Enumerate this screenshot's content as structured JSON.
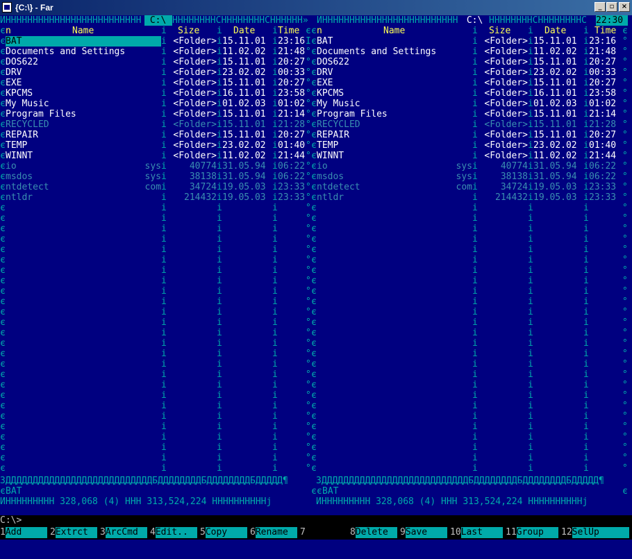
{
  "window": {
    "title": "{C:\\} - Far",
    "btn_min": "_",
    "btn_max": "▫",
    "btn_close": "×"
  },
  "clock": "22:30",
  "left_panel": {
    "path": " C:\\ ",
    "headers": {
      "n": "n",
      "name": "Name",
      "size": "Size",
      "date": "Date",
      "time": "Time"
    },
    "files": [
      {
        "name": "BAT",
        "size": "<Folder>",
        "date": "15.11.01",
        "time": "23:16",
        "type": "folder",
        "selected": true
      },
      {
        "name": "Documents and Settings",
        "size": "<Folder>",
        "date": "11.02.02",
        "time": "21:48",
        "type": "folder"
      },
      {
        "name": "DOS622",
        "size": "<Folder>",
        "date": "15.11.01",
        "time": "20:27",
        "type": "folder"
      },
      {
        "name": "DRV",
        "size": "<Folder>",
        "date": "23.02.02",
        "time": "00:33",
        "type": "folder"
      },
      {
        "name": "EXE",
        "size": "<Folder>",
        "date": "15.11.01",
        "time": "20:27",
        "type": "folder"
      },
      {
        "name": "KPCMS",
        "size": "<Folder>",
        "date": "16.11.01",
        "time": "23:58",
        "type": "folder"
      },
      {
        "name": "My Music",
        "size": "<Folder>",
        "date": "01.02.03",
        "time": "01:02",
        "type": "folder"
      },
      {
        "name": "Program Files",
        "size": "<Folder>",
        "date": "15.11.01",
        "time": "21:14",
        "type": "folder"
      },
      {
        "name": "RECYCLED",
        "size": "<Folder>",
        "date": "15.11.01",
        "time": "21:28",
        "type": "hidden"
      },
      {
        "name": "REPAIR",
        "size": "<Folder>",
        "date": "15.11.01",
        "time": "20:27",
        "type": "folder"
      },
      {
        "name": "TEMP",
        "size": "<Folder>",
        "date": "23.02.02",
        "time": "01:40",
        "type": "folder"
      },
      {
        "name": "WINNT",
        "size": "<Folder>",
        "date": "11.02.02",
        "time": "21:44",
        "type": "folder"
      },
      {
        "name": "io",
        "ext": "sys",
        "size": "40774",
        "date": "31.05.94",
        "time": "06:22",
        "type": "hidden"
      },
      {
        "name": "msdos",
        "ext": "sys",
        "size": "38138",
        "date": "31.05.94",
        "time": "06:22",
        "type": "hidden"
      },
      {
        "name": "ntdetect",
        "ext": "com",
        "size": "34724",
        "date": "19.05.03",
        "time": "23:33",
        "type": "hidden"
      },
      {
        "name": "ntldr",
        "ext": "",
        "size": "214432",
        "date": "19.05.03",
        "time": "23:33",
        "type": "hidden"
      }
    ],
    "current": "BAT",
    "summary": "ИННННННННН 328,068 (4) ННН 313,524,224 ННННННННННј"
  },
  "right_panel": {
    "path": " C:\\ ",
    "headers": {
      "n": "n",
      "name": "Name",
      "size": "Size",
      "date": "Date",
      "time": "Time"
    },
    "files": [
      {
        "name": "BAT",
        "size": "<Folder>",
        "date": "15.11.01",
        "time": "23:16",
        "type": "folder"
      },
      {
        "name": "Documents and Settings",
        "size": "<Folder>",
        "date": "11.02.02",
        "time": "21:48",
        "type": "folder"
      },
      {
        "name": "DOS622",
        "size": "<Folder>",
        "date": "15.11.01",
        "time": "20:27",
        "type": "folder"
      },
      {
        "name": "DRV",
        "size": "<Folder>",
        "date": "23.02.02",
        "time": "00:33",
        "type": "folder"
      },
      {
        "name": "EXE",
        "size": "<Folder>",
        "date": "15.11.01",
        "time": "20:27",
        "type": "folder"
      },
      {
        "name": "KPCMS",
        "size": "<Folder>",
        "date": "16.11.01",
        "time": "23:58",
        "type": "folder"
      },
      {
        "name": "My Music",
        "size": "<Folder>",
        "date": "01.02.03",
        "time": "01:02",
        "type": "folder"
      },
      {
        "name": "Program Files",
        "size": "<Folder>",
        "date": "15.11.01",
        "time": "21:14",
        "type": "folder"
      },
      {
        "name": "RECYCLED",
        "size": "<Folder>",
        "date": "15.11.01",
        "time": "21:28",
        "type": "hidden"
      },
      {
        "name": "REPAIR",
        "size": "<Folder>",
        "date": "15.11.01",
        "time": "20:27",
        "type": "folder"
      },
      {
        "name": "TEMP",
        "size": "<Folder>",
        "date": "23.02.02",
        "time": "01:40",
        "type": "folder"
      },
      {
        "name": "WINNT",
        "size": "<Folder>",
        "date": "11.02.02",
        "time": "21:44",
        "type": "folder"
      },
      {
        "name": "io",
        "ext": "sys",
        "size": "40774",
        "date": "31.05.94",
        "time": "06:22",
        "type": "hidden"
      },
      {
        "name": "msdos",
        "ext": "sys",
        "size": "38138",
        "date": "31.05.94",
        "time": "06:22",
        "type": "hidden"
      },
      {
        "name": "ntdetect",
        "ext": "com",
        "size": "34724",
        "date": "19.05.03",
        "time": "23:33",
        "type": "hidden"
      },
      {
        "name": "ntldr",
        "ext": "",
        "size": "214432",
        "date": "19.05.03",
        "time": "23:33",
        "type": "hidden"
      }
    ],
    "current": "BAT",
    "summary": "ИННННННННН 328,068 (4) ННН 313,524,224 ННННННННННј"
  },
  "command_line": "C:\\>",
  "keybar": [
    {
      "num": "1",
      "label": "Add"
    },
    {
      "num": "2",
      "label": "Extrct"
    },
    {
      "num": "3",
      "label": "ArcCmd"
    },
    {
      "num": "4",
      "label": "Edit.."
    },
    {
      "num": "5",
      "label": "Copy"
    },
    {
      "num": "6",
      "label": "Rename"
    },
    {
      "num": "7",
      "label": ""
    },
    {
      "num": "8",
      "label": "Delete"
    },
    {
      "num": "9",
      "label": "Save"
    },
    {
      "num": "10",
      "label": "Last"
    },
    {
      "num": "11",
      "label": "Group"
    },
    {
      "num": "12",
      "label": "SelUp"
    }
  ],
  "colors": {
    "panel_bg": "#000080",
    "border": "#00aaaa",
    "folder": "#ffffff",
    "hidden": "#3a8fb0",
    "header": "#ffff55",
    "cursor": "#00aaaa"
  }
}
